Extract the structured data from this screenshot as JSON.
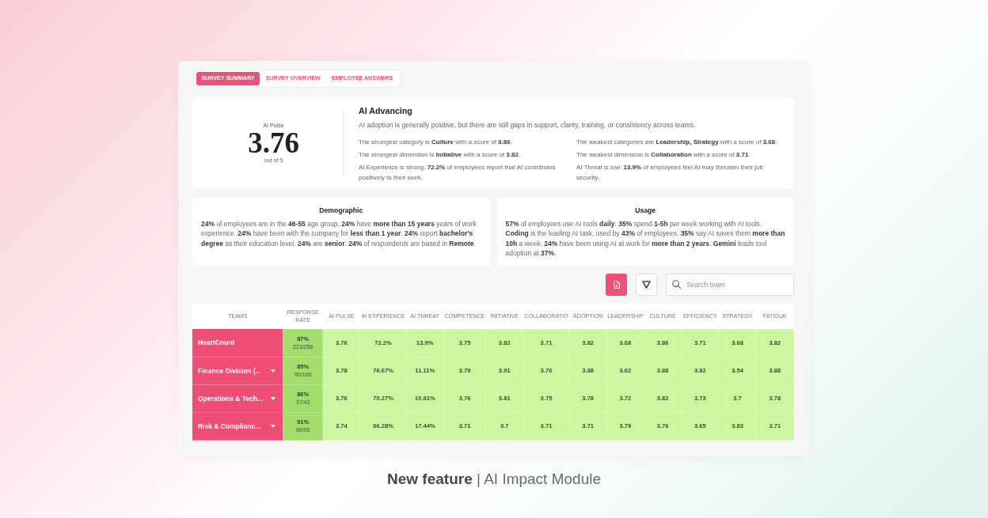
{
  "tabs": [
    {
      "label": "SURVEY SUMMARY",
      "selected": true
    },
    {
      "label": "SURVEY OVERVIEW",
      "selected": false
    },
    {
      "label": "EMPLOYEE ANSWERS",
      "selected": false
    }
  ],
  "summary": {
    "pulse_label": "AI Pulse",
    "pulse_score": "3.76",
    "pulse_scale": "out of 5",
    "title": "AI Advancing",
    "description": "AI adoption is generally positive, but there are still gaps in support, clarity, training, or consistency across teams.",
    "insights": [
      "The strongest category is **Culture** with a score of **3.86**.",
      "The weakest categories are **Leadership, Strategy** with a score of **3.68**.",
      "The strongest dimension is **Initiative** with a score of **3.82**.",
      "The weakest dimension is **Collaboration** with a score of **3.71**.",
      "AI Experience is strong: **72.2%** of employees report that AI contributes positively to their work.",
      "AI Threat is low: **13.9%** of employees feel AI may threaten their job security."
    ]
  },
  "highlights": [
    {
      "title": "Demographic",
      "text": "**24%** of employees are in the **46-55** age group. **24%** have **more than 15 years** years of work experience. **24%** have been with the company for **less than 1 year**. **24%** report **bachelor's degree** as their education level. **24%** are **senior**. **24%** of respondents are based in **Remote**."
    },
    {
      "title": "Usage",
      "text": "**57%** of employees use AI tools **daily**. **35%** spend **1-5h** per week working with AI tools. **Coding** is the leading AI task, used by **43%** of employees. **35%** say AI saves them **more than 10h** a week. **24%** have been using AI at work for **more than 2 years**. **Gemini** leads tool adoption at **37%**."
    }
  ],
  "toolbar": {
    "search": {
      "placeholder": "Search team"
    }
  },
  "table": {
    "columns": [
      "TEAMS",
      "RESPONSE RATE",
      "AI PULSE",
      "AI EXPERIENCE",
      "AI THREAT",
      "COMPETENCE",
      "INITIATIVE",
      "COLLABORATIO",
      "ADOPTION",
      "LEADERSHIP",
      "CULTURE",
      "EFFICIENCY",
      "STRATEGY",
      "FATIGUE"
    ],
    "rows": [
      {
        "team": "HeartCount",
        "expandable": false,
        "response_rate": "87%",
        "responses": "223/256",
        "scores": [
          "3.76",
          "72.2%",
          "13.9%",
          "3.75",
          "3.82",
          "3.71",
          "3.82",
          "3.68",
          "3.86",
          "3.71",
          "3.68",
          "3.82"
        ]
      },
      {
        "team": "Finance Division (...",
        "expandable": true,
        "response_rate": "85%",
        "responses": "90/106",
        "scores": [
          "3.78",
          "76.67%",
          "11.11%",
          "3.79",
          "3.91",
          "3.76",
          "3.88",
          "3.62",
          "3.88",
          "3.82",
          "3.54",
          "3.88"
        ]
      },
      {
        "team": "Operations & Tech...",
        "expandable": true,
        "response_rate": "86%",
        "responses": "37/43",
        "scores": [
          "3.76",
          "70.27%",
          "10.81%",
          "3.76",
          "3.81",
          "3.75",
          "3.78",
          "3.72",
          "3.82",
          "3.73",
          "3.7",
          "3.78"
        ]
      },
      {
        "team": "Risk & Complianc...",
        "expandable": true,
        "response_rate": "91%",
        "responses": "86/95",
        "scores": [
          "3.74",
          "66.28%",
          "17.44%",
          "3.71",
          "3.7",
          "3.71",
          "3.71",
          "3.79",
          "3.76",
          "3.65",
          "3.83",
          "3.71"
        ]
      }
    ]
  },
  "caption": "**New feature** | AI Impact Module"
}
